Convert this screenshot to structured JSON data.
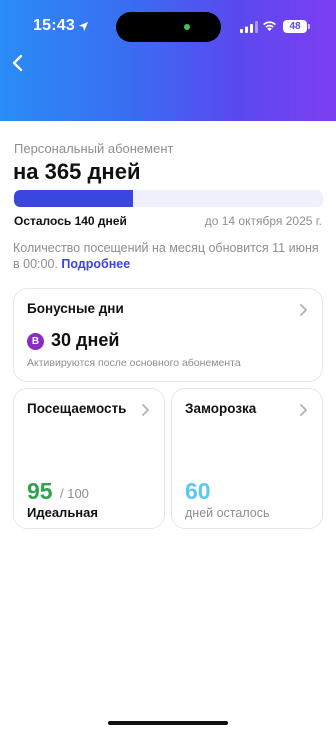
{
  "status_bar": {
    "time": "15:43",
    "battery": "48",
    "icons": [
      "location-arrow-icon",
      "signal-icon",
      "wifi-icon",
      "battery-icon"
    ]
  },
  "header": {
    "back_icon": "chevron-left-icon",
    "gradient_colors": [
      "#2a8cf5",
      "#5a49ef",
      "#7d3ef0"
    ]
  },
  "subscription": {
    "type_label": "Персональный абонемент",
    "title": "на 365 дней",
    "progress_fraction": 0.384,
    "progress_color": "#3b45e0",
    "remaining": "Осталось 140 дней",
    "until": "до 14 октября 2025 г.",
    "visits_info": "Количество посещений на месяц обновится 11 июня в 00:00. ",
    "more_link": "Подробнее"
  },
  "bonus_card": {
    "title": "Бонусные дни",
    "badge": "B",
    "badge_color": "#8e2bc0",
    "value": "30 дней",
    "note": "Активируются после основного абонемента"
  },
  "attendance_card": {
    "title": "Посещаемость",
    "value": "95",
    "max": "/ 100",
    "label": "Идеальная",
    "value_color": "#30a14e"
  },
  "freeze_card": {
    "title": "Заморозка",
    "value": "60",
    "label": "дней осталось",
    "value_color": "#5ac8f2"
  }
}
